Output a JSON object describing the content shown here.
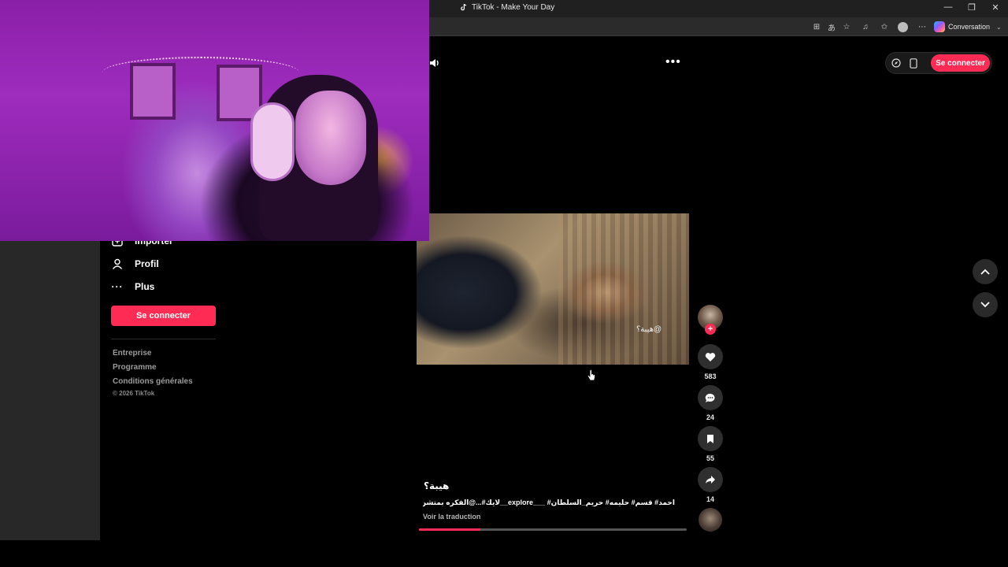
{
  "browser": {
    "tab_title": "TikTok - Make Your Day",
    "copilot_label": "Conversation",
    "window_controls": {
      "minimize": "—",
      "restore": "❐",
      "close": "✕"
    },
    "toolbar_icons": [
      "translate-icon",
      "read-aloud-icon",
      "favorite-star-icon",
      "music-icon",
      "collections-icon",
      "profile-icon",
      "more-icon"
    ]
  },
  "sidebar": {
    "items": [
      {
        "label": "Importer",
        "icon": "upload-icon"
      },
      {
        "label": "Profil",
        "icon": "person-icon"
      },
      {
        "label": "Plus",
        "icon": "more-dots-icon"
      }
    ],
    "login_label": "Se connecter",
    "footer_links": [
      "Entreprise",
      "Programme",
      "Conditions générales"
    ],
    "copyright": "© 2026 TikTok"
  },
  "top_right": {
    "login_label": "Se connecter"
  },
  "video": {
    "watermark": "@هيبة؟",
    "progress": 0.23
  },
  "actions": {
    "likes": "583",
    "comments": "24",
    "saves": "55",
    "shares": "14"
  },
  "caption": {
    "title": "هيبة؟",
    "tags": "احمد# قسم# حليمه# حريم_السلطان# ___explore__لايك#...@الفكره بمتشن . . ..",
    "translate_label": "Voir la traduction"
  },
  "colors": {
    "accent": "#fe2c55",
    "background": "#000000"
  }
}
